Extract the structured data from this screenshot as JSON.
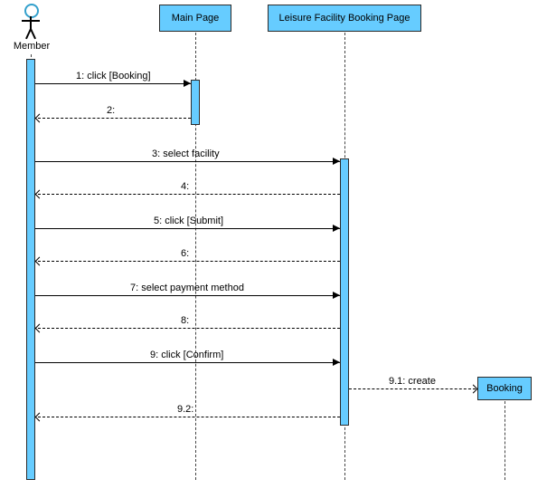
{
  "actor": {
    "name": "Member"
  },
  "participants": {
    "main_page": "Main Page",
    "booking_page": "Leisure Facility Booking Page",
    "booking_obj": "Booking"
  },
  "messages": {
    "m1": "1: click [Booking]",
    "m2": "2:",
    "m3": "3: select facility",
    "m4": "4:",
    "m5": "5: click [Submit]",
    "m6": "6:",
    "m7": "7: select payment method",
    "m8": "8:",
    "m9": "9: click [Confirm]",
    "m9_1": "9.1: create",
    "m9_2": "9.2:"
  },
  "chart_data": {
    "type": "sequence_diagram",
    "participants": [
      {
        "id": "member",
        "label": "Member",
        "kind": "actor"
      },
      {
        "id": "main_page",
        "label": "Main Page",
        "kind": "object"
      },
      {
        "id": "booking_page",
        "label": "Leisure Facility Booking Page",
        "kind": "object"
      },
      {
        "id": "booking",
        "label": "Booking",
        "kind": "object",
        "created_by": "9.1"
      }
    ],
    "messages": [
      {
        "seq": "1",
        "from": "member",
        "to": "main_page",
        "label": "click [Booking]",
        "type": "sync"
      },
      {
        "seq": "2",
        "from": "main_page",
        "to": "member",
        "label": "",
        "type": "return"
      },
      {
        "seq": "3",
        "from": "member",
        "to": "booking_page",
        "label": "select facility",
        "type": "sync"
      },
      {
        "seq": "4",
        "from": "booking_page",
        "to": "member",
        "label": "",
        "type": "return"
      },
      {
        "seq": "5",
        "from": "member",
        "to": "booking_page",
        "label": "click [Submit]",
        "type": "sync"
      },
      {
        "seq": "6",
        "from": "booking_page",
        "to": "member",
        "label": "",
        "type": "return"
      },
      {
        "seq": "7",
        "from": "member",
        "to": "booking_page",
        "label": "select payment method",
        "type": "sync"
      },
      {
        "seq": "8",
        "from": "booking_page",
        "to": "member",
        "label": "",
        "type": "return"
      },
      {
        "seq": "9",
        "from": "member",
        "to": "booking_page",
        "label": "click [Confirm]",
        "type": "sync"
      },
      {
        "seq": "9.1",
        "from": "booking_page",
        "to": "booking",
        "label": "create",
        "type": "create"
      },
      {
        "seq": "9.2",
        "from": "booking_page",
        "to": "member",
        "label": "",
        "type": "return"
      }
    ]
  }
}
